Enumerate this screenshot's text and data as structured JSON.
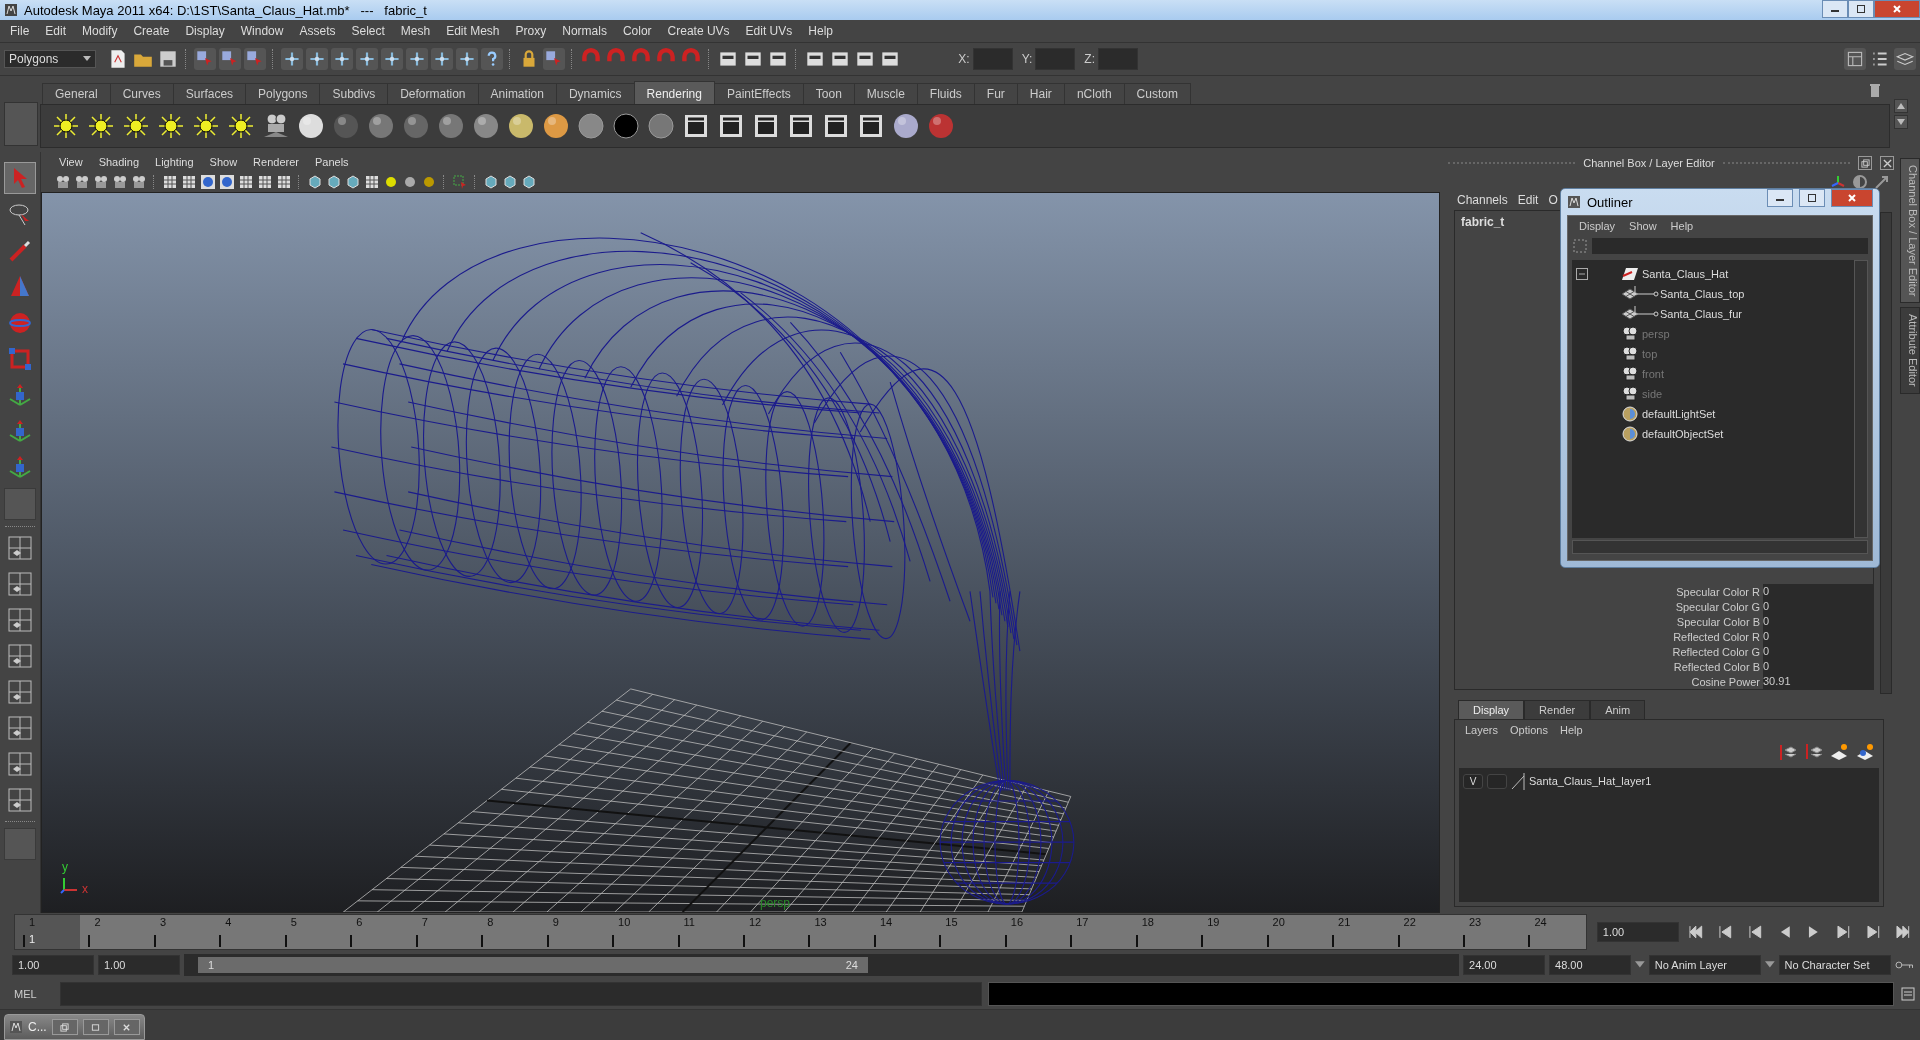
{
  "window": {
    "title": "Autodesk Maya 2011 x64: D:\\1ST\\Santa_Claus_Hat.mb*   ---   fabric_t"
  },
  "menu_bar": [
    "File",
    "Edit",
    "Modify",
    "Create",
    "Display",
    "Window",
    "Assets",
    "Select",
    "Mesh",
    "Edit Mesh",
    "Proxy",
    "Normals",
    "Color",
    "Create UVs",
    "Edit UVs",
    "Help"
  ],
  "status_line": {
    "mode": "Polygons",
    "xyz_labels": [
      "X:",
      "Y:",
      "Z:"
    ]
  },
  "shelf": {
    "tabs": [
      {
        "label": "General",
        "selected": false
      },
      {
        "label": "Curves",
        "selected": false
      },
      {
        "label": "Surfaces",
        "selected": false
      },
      {
        "label": "Polygons",
        "selected": false
      },
      {
        "label": "Subdivs",
        "selected": false
      },
      {
        "label": "Deformation",
        "selected": false
      },
      {
        "label": "Animation",
        "selected": false
      },
      {
        "label": "Dynamics",
        "selected": false
      },
      {
        "label": "Rendering",
        "selected": true
      },
      {
        "label": "PaintEffects",
        "selected": false
      },
      {
        "label": "Toon",
        "selected": false
      },
      {
        "label": "Muscle",
        "selected": false
      },
      {
        "label": "Fluids",
        "selected": false
      },
      {
        "label": "Fur",
        "selected": false
      },
      {
        "label": "Hair",
        "selected": false
      },
      {
        "label": "nCloth",
        "selected": false
      },
      {
        "label": "Custom",
        "selected": false
      }
    ]
  },
  "viewport": {
    "menu": [
      "View",
      "Shading",
      "Lighting",
      "Show",
      "Renderer",
      "Panels"
    ],
    "axis_labels": [
      "y",
      "x"
    ],
    "camera_label": "persp"
  },
  "channel_box": {
    "title": "Channel Box / Layer Editor",
    "menu": [
      "Channels",
      "Edit",
      "O"
    ],
    "object_name": "fabric_t",
    "attributes": [
      {
        "name": "Specular Color R",
        "value": "0"
      },
      {
        "name": "Specular Color G",
        "value": "0"
      },
      {
        "name": "Specular Color B",
        "value": "0"
      },
      {
        "name": "Reflected Color R",
        "value": "0"
      },
      {
        "name": "Reflected Color G",
        "value": "0"
      },
      {
        "name": "Reflected Color B",
        "value": "0"
      },
      {
        "name": "Cosine Power",
        "value": "30.91"
      }
    ]
  },
  "outliner": {
    "title": "Outliner",
    "menu": [
      "Display",
      "Show",
      "Help"
    ],
    "items": [
      {
        "label": "Santa_Claus_Hat",
        "kind": "transform",
        "dimmed": false,
        "expanded": true,
        "children": [
          {
            "label": "Santa_Claus_top",
            "kind": "mesh",
            "dimmed": false
          },
          {
            "label": "Santa_Claus_fur",
            "kind": "mesh",
            "dimmed": false
          }
        ]
      },
      {
        "label": "persp",
        "kind": "camera",
        "dimmed": true
      },
      {
        "label": "top",
        "kind": "camera",
        "dimmed": true
      },
      {
        "label": "front",
        "kind": "camera",
        "dimmed": true
      },
      {
        "label": "side",
        "kind": "camera",
        "dimmed": true
      },
      {
        "label": "defaultLightSet",
        "kind": "set",
        "dimmed": false
      },
      {
        "label": "defaultObjectSet",
        "kind": "set",
        "dimmed": false
      }
    ]
  },
  "layer_editor": {
    "tabs": [
      {
        "label": "Display",
        "selected": true
      },
      {
        "label": "Render",
        "selected": false
      },
      {
        "label": "Anim",
        "selected": false
      }
    ],
    "menu": [
      "Layers",
      "Options",
      "Help"
    ],
    "layers": [
      {
        "visibility": "V",
        "name": "Santa_Claus_Hat_layer1"
      }
    ]
  },
  "side_tabs": [
    "Channel Box / Layer Editor",
    "Attribute Editor"
  ],
  "time_slider": {
    "ticks": [
      {
        "label": "1",
        "selected": true
      },
      {
        "label": "2",
        "selected": false
      },
      {
        "label": "3",
        "selected": false
      },
      {
        "label": "4",
        "selected": false
      },
      {
        "label": "5",
        "selected": false
      },
      {
        "label": "6",
        "selected": false
      },
      {
        "label": "7",
        "selected": false
      },
      {
        "label": "8",
        "selected": false
      },
      {
        "label": "9",
        "selected": false
      },
      {
        "label": "10",
        "selected": false
      },
      {
        "label": "11",
        "selected": false
      },
      {
        "label": "12",
        "selected": false
      },
      {
        "label": "13",
        "selected": false
      },
      {
        "label": "14",
        "selected": false
      },
      {
        "label": "15",
        "selected": false
      },
      {
        "label": "16",
        "selected": false
      },
      {
        "label": "17",
        "selected": false
      },
      {
        "label": "18",
        "selected": false
      },
      {
        "label": "19",
        "selected": false
      },
      {
        "label": "20",
        "selected": false
      },
      {
        "label": "21",
        "selected": false
      },
      {
        "label": "22",
        "selected": false
      },
      {
        "label": "23",
        "selected": false
      },
      {
        "label": "24",
        "selected": false
      }
    ],
    "current_label": "1",
    "current_frame": "1.00"
  },
  "range_slider": {
    "start_time": "1.00",
    "playback_start": "1.00",
    "range_start": "1",
    "range_end": "24",
    "playback_end": "24.00",
    "end_time": "48.00",
    "anim_layer": "No Anim Layer",
    "character_set": "No Character Set"
  },
  "command_line": {
    "label": "MEL"
  },
  "taskbar": {
    "items": [
      {
        "label": "C..."
      }
    ]
  }
}
